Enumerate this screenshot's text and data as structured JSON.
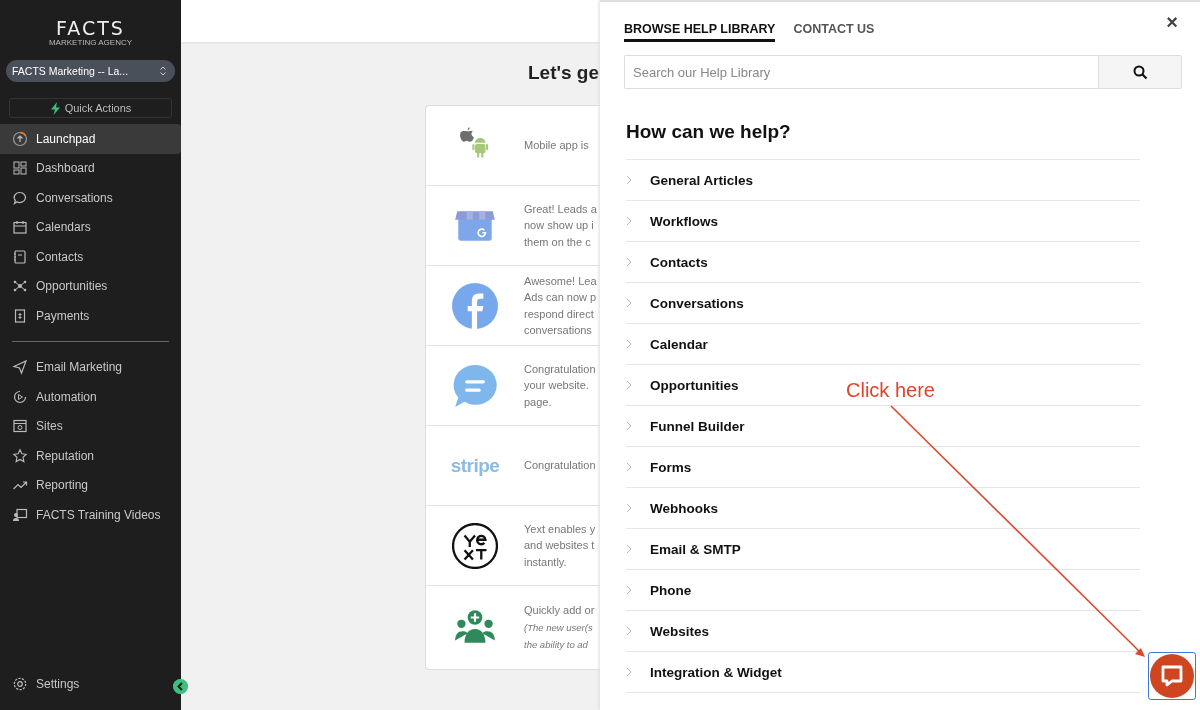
{
  "sidebar": {
    "logo": "FACTS",
    "logo_subtitle": "MARKETING AGENCY",
    "account": "FACTS Marketing -- La...",
    "quick_actions": "Quick Actions",
    "groups": [
      [
        {
          "label": "Launchpad",
          "selected": true
        },
        {
          "label": "Dashboard",
          "selected": false
        },
        {
          "label": "Conversations",
          "selected": false
        },
        {
          "label": "Calendars",
          "selected": false
        },
        {
          "label": "Contacts",
          "selected": false
        },
        {
          "label": "Opportunities",
          "selected": false
        },
        {
          "label": "Payments",
          "selected": false
        }
      ],
      [
        {
          "label": "Email Marketing",
          "selected": false
        },
        {
          "label": "Automation",
          "selected": false
        },
        {
          "label": "Sites",
          "selected": false
        },
        {
          "label": "Reputation",
          "selected": false
        },
        {
          "label": "Reporting",
          "selected": false
        },
        {
          "label": "FACTS Training Videos",
          "selected": false
        }
      ]
    ],
    "settings": "Settings"
  },
  "main": {
    "title": "Let's ge",
    "cards": [
      {
        "lines": [
          "Mobile app is"
        ]
      },
      {
        "lines": [
          "Great! Leads a",
          "now show up i",
          "them on the c"
        ]
      },
      {
        "lines": [
          "Awesome! Lea",
          "Ads can now p",
          "respond direct",
          "conversations"
        ]
      },
      {
        "lines": [
          "Congratulation",
          "your website.",
          "page."
        ]
      },
      {
        "logo": "stripe",
        "lines": [
          "Congratulation"
        ]
      },
      {
        "lines": [
          "Yext enables y",
          "and websites t",
          "instantly."
        ]
      },
      {
        "lines": [
          "Quickly add or"
        ],
        "note_lines": [
          "(The new user(s",
          "the ability to ad"
        ]
      }
    ]
  },
  "help": {
    "tabs": [
      {
        "label": "BROWSE HELP LIBRARY",
        "selected": true
      },
      {
        "label": "CONTACT US",
        "selected": false
      }
    ],
    "close": "×",
    "search": {
      "placeholder": "Search our Help Library"
    },
    "heading": "How can we help?",
    "topics": [
      "General Articles",
      "Workflows",
      "Contacts",
      "Conversations",
      "Calendar",
      "Opportunities",
      "Funnel Builder",
      "Forms",
      "Webhooks",
      "Email & SMTP",
      "Phone",
      "Websites",
      "Integration & Widget"
    ]
  },
  "annotation": {
    "text": "Click here"
  }
}
